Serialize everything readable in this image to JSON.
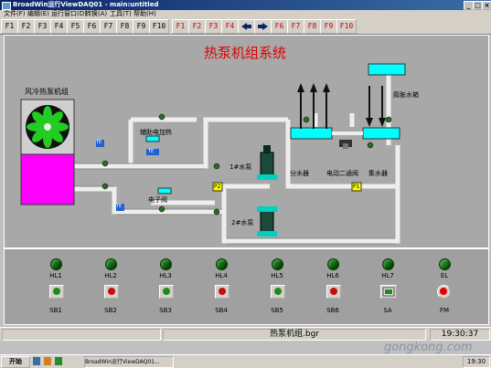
{
  "window": {
    "title": "BroadWin运行ViewDAQ01 - main:untitled"
  },
  "menu": {
    "items": [
      "文件(F)",
      "编辑(E)",
      "运行窗口(D)",
      "转换(A)",
      "工具(T)",
      "帮助(H)"
    ]
  },
  "toolbar": {
    "left_keys": [
      "F1",
      "F2",
      "F3",
      "F4",
      "F5",
      "F6",
      "F7",
      "F8",
      "F9",
      "F10"
    ],
    "right_keys_a": [
      "F1",
      "F2",
      "F3",
      "F4"
    ],
    "right_keys_b": [
      "F6",
      "F7",
      "F8",
      "F9",
      "F10"
    ],
    "accent": "#d00000"
  },
  "diagram": {
    "title": "热泵机组系统",
    "unit_label": "风冷热泵机组",
    "aux_heater": "辅助电加热",
    "electronic_valve": "电子阀",
    "expansion_tank": "膨胀水箱",
    "pump1": "1#水泵",
    "pump2": "2#水泵",
    "distributor": "分水器",
    "two_way_valve": "电动二通阀",
    "collector": "集水器",
    "t_left": "TE",
    "t_mid": "TE",
    "t_bottom": "TE",
    "p2": "P2",
    "p1": "P1"
  },
  "panel": {
    "lamps": [
      {
        "label": "HL1",
        "state": "off"
      },
      {
        "label": "HL2",
        "state": "off"
      },
      {
        "label": "HL3",
        "state": "off"
      },
      {
        "label": "HL4",
        "state": "off"
      },
      {
        "label": "HL5",
        "state": "off"
      },
      {
        "label": "HL6",
        "state": "off"
      },
      {
        "label": "HL7",
        "state": "off"
      },
      {
        "label": "EL",
        "state": "off"
      }
    ],
    "buttons": [
      {
        "label": "SB1",
        "color": "#1e8a1e"
      },
      {
        "label": "SB2",
        "color": "#c01010"
      },
      {
        "label": "SB3",
        "color": "#1e8a1e"
      },
      {
        "label": "SB4",
        "color": "#c01010"
      },
      {
        "label": "SB5",
        "color": "#1e8a1e"
      },
      {
        "label": "SB6",
        "color": "#c01010"
      },
      {
        "label": "SA",
        "color": "#1e8a1e"
      },
      {
        "label": "FM",
        "color": "#e00000"
      }
    ]
  },
  "status": {
    "file": "热泵机组.bgr",
    "time": "19:30:37"
  },
  "taskbar": {
    "start": "开始",
    "task": "BroadWin运行ViewDAQ01...",
    "clock": "19:30"
  },
  "watermark": "gongkong.com"
}
